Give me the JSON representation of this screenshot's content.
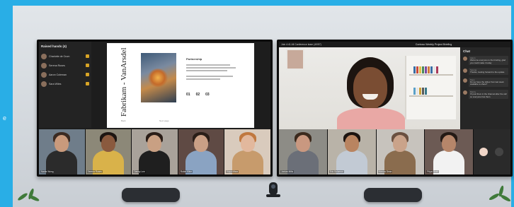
{
  "sidebar_hint": "e",
  "left_screen": {
    "panel_title": "Raised hands (4)",
    "participants": [
      {
        "name": "Charlotte de Crum"
      },
      {
        "name": "Serena Ruses"
      },
      {
        "name": "Aaron Coleman"
      },
      {
        "name": "Sara Wiles"
      }
    ],
    "doc": {
      "vertical_title": "Fabrikam - VanArsdel",
      "heading": "Partnership",
      "stats": [
        "01",
        "02",
        "03"
      ],
      "foot_left": "Back",
      "foot_right": "Next page"
    },
    "gallery": [
      {
        "name": "Nadia Wong",
        "skin": "#c99a7c",
        "hair": "#3a2a22",
        "shirt": "#2b2b2b",
        "bg": "#6f7d8a"
      },
      {
        "name": "Serena Ruses",
        "skin": "#8a5a3e",
        "hair": "#1d1612",
        "shirt": "#d9b24a",
        "bg": "#8c8878"
      },
      {
        "name": "Danny Lee",
        "skin": "#c9a083",
        "hair": "#2a1d17",
        "shirt": "#1f1f1f",
        "bg": "#a9a29a"
      },
      {
        "name": "Robin Kline",
        "skin": "#caa086",
        "hair": "#2a1e18",
        "shirt": "#8aa3c2",
        "bg": "#5f4a44"
      },
      {
        "name": "Kayo Miwa",
        "skin": "#e2b89d",
        "hair": "#c0783f",
        "shirt": "#c79b6c",
        "bg": "#d9cbbd"
      }
    ]
  },
  "right_screen": {
    "topbar_left": "Join 4:41  All Conference team (40/57)",
    "title": "Contoso Weekly Project Briefing",
    "speaker_name": "",
    "chat": {
      "title": "Chat",
      "messages": [
        {
          "meta": "Aaron",
          "text": "Welcome everyone to the briefing, glad you could make it today"
        },
        {
          "meta": "Serena",
          "text": "Thanks, looking forward to the update"
        },
        {
          "meta": "Kayo",
          "text": "Do we have the slides from last week available to share?"
        },
        {
          "meta": "Danny",
          "text": "I'll post them in the channel after the call so everyone has them"
        }
      ]
    },
    "gallery": [
      {
        "name": "Jordan Mills",
        "skin": "#c99880",
        "hair": "#3b2a1e",
        "shirt": "#6b6f78",
        "bg": "#8d8c86"
      },
      {
        "name": "Eric Solomon",
        "skin": "#b98460",
        "hair": "#1c1410",
        "shirt": "#c2cad4",
        "bg": "#b9b3a8"
      },
      {
        "name": "Marcus Dean",
        "skin": "#caa38a",
        "hair": "#6a5040",
        "shirt": "#8a6c4e",
        "bg": "#c7c3bd"
      },
      {
        "name": "Priya Shah",
        "skin": "#b6866a",
        "hair": "#241a15",
        "shirt": "#f2f2f2",
        "bg": "#6c5a54"
      }
    ]
  },
  "colors": {
    "accent": "#29aee6",
    "raise_hand": "#d8a526",
    "bezel": "#0c0c0c"
  },
  "icons": [
    "raise-hand-icon",
    "avatar-icon",
    "end-call-icon"
  ]
}
